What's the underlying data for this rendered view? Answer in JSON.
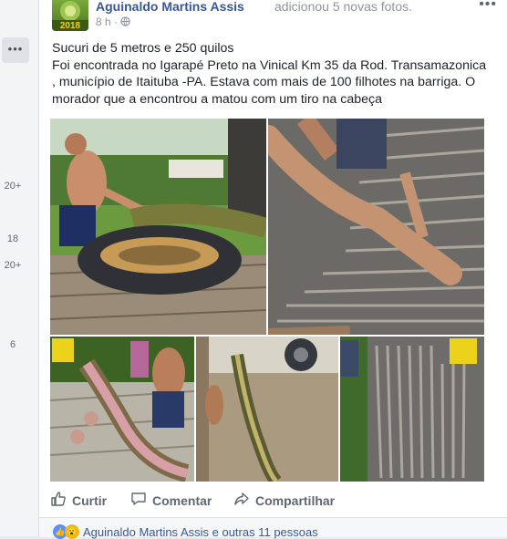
{
  "post": {
    "author": "Aguinaldo Martins Assis",
    "action": "adicionou 5 novas fotos.",
    "time": "8 h",
    "privacy_dot": "·",
    "text_lines": [
      "Sucuri de 5 metros e 250 quilos",
      "Foi encontrada no Igarapé Preto na Vinical Km 35 da Rod. Transamazonica",
      ", município de Itaituba -PA. Estava com mais de 100 filhotes na barriga. O",
      "morador que a encontrou a matou com um tiro na cabeça"
    ],
    "avatar_label": "2018"
  },
  "actions": {
    "like": "Curtir",
    "comment": "Comentar",
    "share": "Compartilhar"
  },
  "reactions": {
    "text": "Aguinaldo Martins Assis e outras 11 pessoas"
  },
  "gutter": {
    "more": "•••",
    "counts": [
      "20+",
      "18",
      "20+",
      "6"
    ]
  },
  "photos": [
    {
      "name": "anaconda-held-photo"
    },
    {
      "name": "babies-on-board-photo"
    },
    {
      "name": "cut-open-snake-photo"
    },
    {
      "name": "snake-on-ground-photo"
    },
    {
      "name": "snake-row-photo"
    }
  ]
}
